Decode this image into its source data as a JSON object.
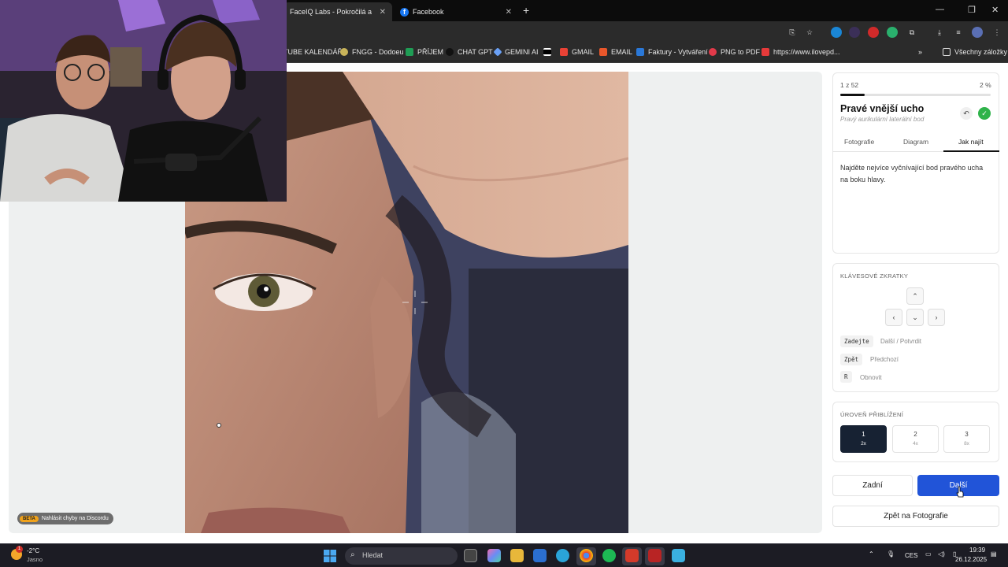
{
  "browser": {
    "tabs": [
      {
        "label": "FaceIQ Labs - Pokročilá analýza",
        "active": true
      },
      {
        "label": "Facebook",
        "active": false
      }
    ],
    "new_tab_label": "+",
    "bookmarks": [
      {
        "label": "TUBE KALENDÁŘ",
        "icon": "calendar-icon"
      },
      {
        "label": "FNGG - Dodoeu",
        "icon": "fngg-icon"
      },
      {
        "label": "PŘÍJEM",
        "icon": "sheets-icon"
      },
      {
        "label": "CHAT GPT",
        "icon": "openai-icon"
      },
      {
        "label": "GEMINI AI",
        "icon": "gemini-icon"
      },
      {
        "label": "GMAIL",
        "icon": "gmail-icon"
      },
      {
        "label": "EMAIL",
        "icon": "email-icon"
      },
      {
        "label": "Faktury - Vytváření",
        "icon": "invoice-icon"
      },
      {
        "label": "PNG to PDF",
        "icon": "heart-icon"
      },
      {
        "label": "https://www.ilovepd...",
        "icon": "ilovepdf-icon"
      }
    ],
    "all_bookmarks_label": "Všechny záložky",
    "more_bookmarks": "»"
  },
  "beta": {
    "tag": "BETA",
    "text": "Nahlásit chyby na Discordu"
  },
  "panel": {
    "progress_label": "1 z 52",
    "progress_percent_label": "2 %",
    "progress_value": 0.02,
    "landmark_title": "Pravé vnější ucho",
    "landmark_subtitle": "Pravý aurikulární laterální bod",
    "tabs": [
      "Fotografie",
      "Diagram",
      "Jak najít"
    ],
    "active_tab": "Jak najít",
    "instruction": "Najděte nejvíce vyčnívající bod pravého ucha na boku hlavy.",
    "shortcuts_heading": "KLÁVESOVÉ ZKRATKY",
    "arrow_keys": {
      "up": "⌃",
      "left": "‹",
      "down": "⌄",
      "right": "›"
    },
    "shortcuts": [
      {
        "key": "Zadejte",
        "desc": "Další / Potvrdit"
      },
      {
        "key": "Zpět",
        "desc": "Předchozí"
      },
      {
        "key": "R",
        "desc": "Obnovit"
      }
    ],
    "zoom_heading": "ÚROVEŇ PŘIBLÍŽENÍ",
    "zoom_levels": [
      {
        "level": "1",
        "scale": "2x",
        "active": true
      },
      {
        "level": "2",
        "scale": "4x",
        "active": false
      },
      {
        "level": "3",
        "scale": "8x",
        "active": false
      }
    ],
    "back_label": "Zadní",
    "next_label": "Další",
    "back_to_photos_label": "Zpět na Fotografie",
    "accent_color": "#2154d8",
    "success_color": "#2fb34a"
  },
  "taskbar": {
    "temperature": "-2°C",
    "condition": "Jasno",
    "weather_badge": "1",
    "search_placeholder": "Hledat",
    "language": "CES",
    "time": "19:39",
    "date": "26.12.2025"
  }
}
